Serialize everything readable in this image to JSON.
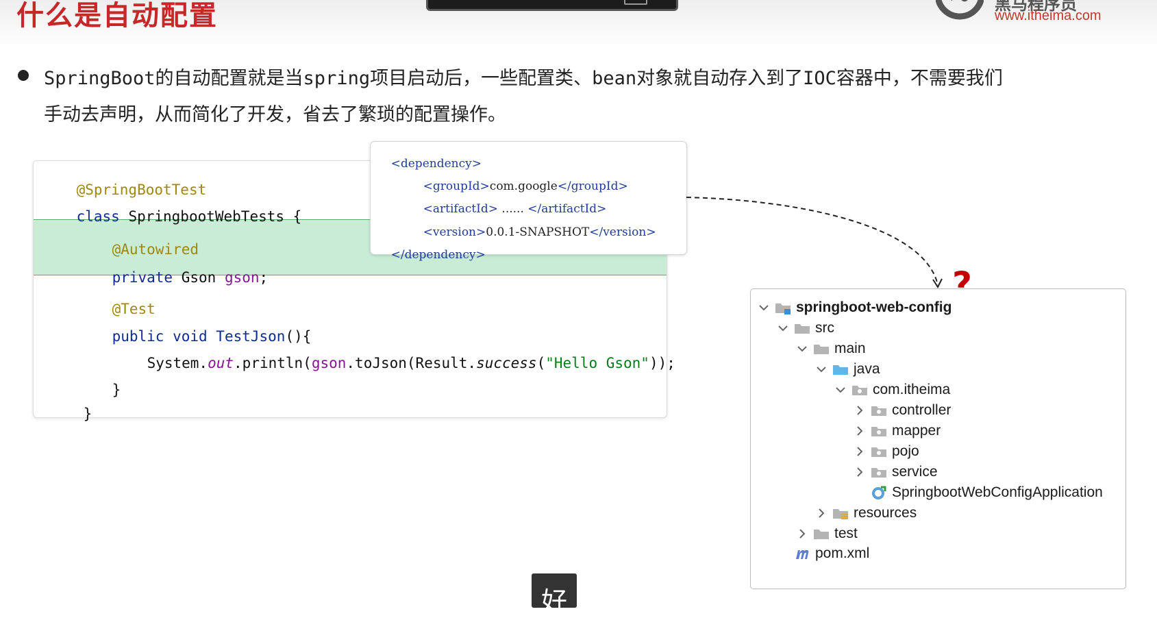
{
  "slide": {
    "title": "什么是自动配置",
    "logo_brand": "黑马程序员",
    "logo_url": "www.itheima.com"
  },
  "bullet": {
    "line1": "SpringBoot的自动配置就是当spring项目启动后，一些配置类、bean对象就自动存入到了IOC容器中，不需要我们",
    "line2": "手动去声明，从而简化了开发，省去了繁琐的配置操作。"
  },
  "code": {
    "annotation_test": "@SpringBootTest",
    "kw_class": "class",
    "class_name": " SpringbootWebTests {",
    "annotation_autowired": "@Autowired",
    "kw_private": "private",
    "type_gson": " Gson ",
    "field_gson": "gson",
    "semicolon": ";",
    "annotation_junit": "@Test",
    "kw_public": "public",
    "kw_void": " void ",
    "method_name": "TestJson",
    "method_parens": "(){",
    "stmt_system": "System.",
    "stmt_out": "out",
    "stmt_println": ".println(",
    "stmt_gson": "gson",
    "stmt_tojson": ".toJson(Result.",
    "stmt_success": "success",
    "stmt_open": "(",
    "stmt_string": "\"Hello Gson\"",
    "stmt_close": "));",
    "close_method": "}",
    "close_class": "}"
  },
  "xml": {
    "open_dependency": "<dependency>",
    "group_open": "<groupId>",
    "group_value": "com.google",
    "group_close": "</groupId>",
    "artifact_open": "<artifactId>",
    "artifact_value": " ...... ",
    "artifact_close": "</artifactId>",
    "version_open": "<version>",
    "version_value": "0.0.1-SNAPSHOT",
    "version_close": "</version>",
    "close_dependency": "</dependency>"
  },
  "tree": {
    "root": "springboot-web-config",
    "src": "src",
    "main": "main",
    "java": "java",
    "package": "com.itheima",
    "controller": "controller",
    "mapper": "mapper",
    "pojo": "pojo",
    "service": "service",
    "app_class": "SpringbootWebConfigApplication",
    "resources": "resources",
    "test": "test",
    "pom": "pom.xml"
  },
  "annotation_mark": "?",
  "subtitle": "好",
  "colors": {
    "title_red": "#c62828",
    "highlight_green": "#c8ecd6",
    "annotation_gold": "#9e880d",
    "keyword_blue": "#0d2c94",
    "field_purple": "#851691",
    "string_green": "#067d17",
    "question_red": "#c40000",
    "java_folder_blue": "#5fb7e8"
  }
}
